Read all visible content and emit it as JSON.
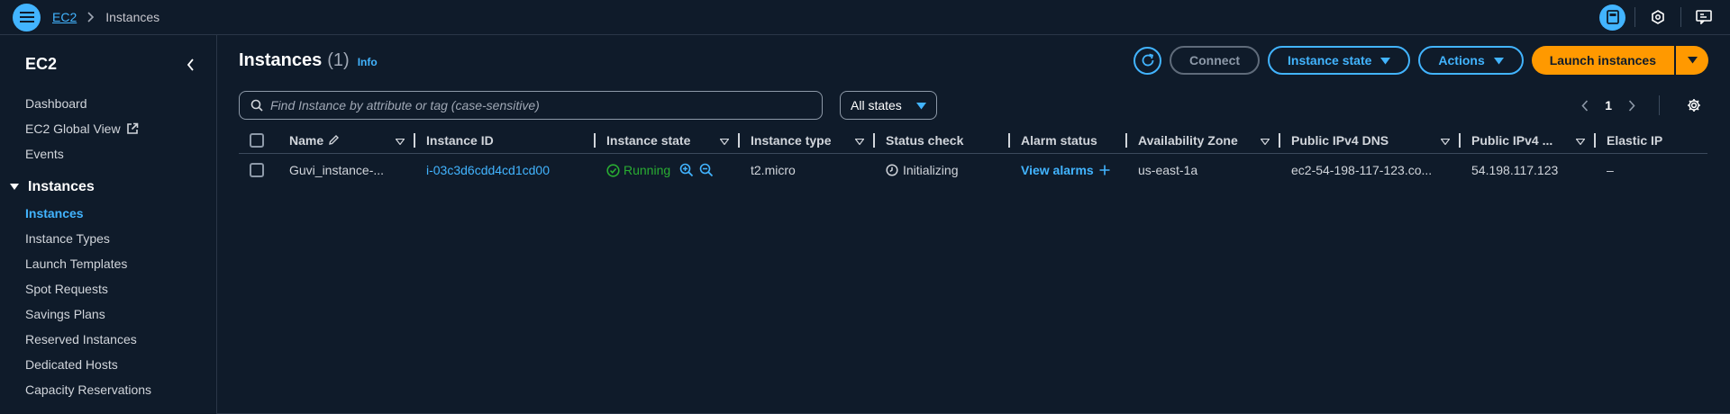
{
  "breadcrumb": {
    "service": "EC2",
    "current": "Instances"
  },
  "sidebar": {
    "title": "EC2",
    "items_top": [
      "Dashboard",
      "EC2 Global View",
      "Events"
    ],
    "group": "Instances",
    "group_items": [
      "Instances",
      "Instance Types",
      "Launch Templates",
      "Spot Requests",
      "Savings Plans",
      "Reserved Instances",
      "Dedicated Hosts",
      "Capacity Reservations"
    ]
  },
  "header": {
    "title": "Instances",
    "count": "(1)",
    "info": "Info",
    "connect": "Connect",
    "instance_state": "Instance state",
    "actions": "Actions",
    "launch": "Launch instances"
  },
  "filter": {
    "placeholder": "Find Instance by attribute or tag (case-sensitive)",
    "states": "All states",
    "page": "1"
  },
  "table": {
    "columns": [
      "Name",
      "Instance ID",
      "Instance state",
      "Instance type",
      "Status check",
      "Alarm status",
      "Availability Zone",
      "Public IPv4 DNS",
      "Public IPv4 ...",
      "Elastic IP"
    ],
    "rows": [
      {
        "name": "Guvi_instance-...",
        "id": "i-03c3d6cdd4cd1cd00",
        "state": "Running",
        "type": "t2.micro",
        "status": "Initializing",
        "alarm": "View alarms",
        "az": "us-east-1a",
        "dns": "ec2-54-198-117-123.co...",
        "ip": "54.198.117.123",
        "eip": "–"
      }
    ]
  },
  "colors": {
    "accent": "#42b4ff",
    "launch": "#ff9900",
    "running": "#29ad32",
    "bg": "#0f1b2a"
  }
}
